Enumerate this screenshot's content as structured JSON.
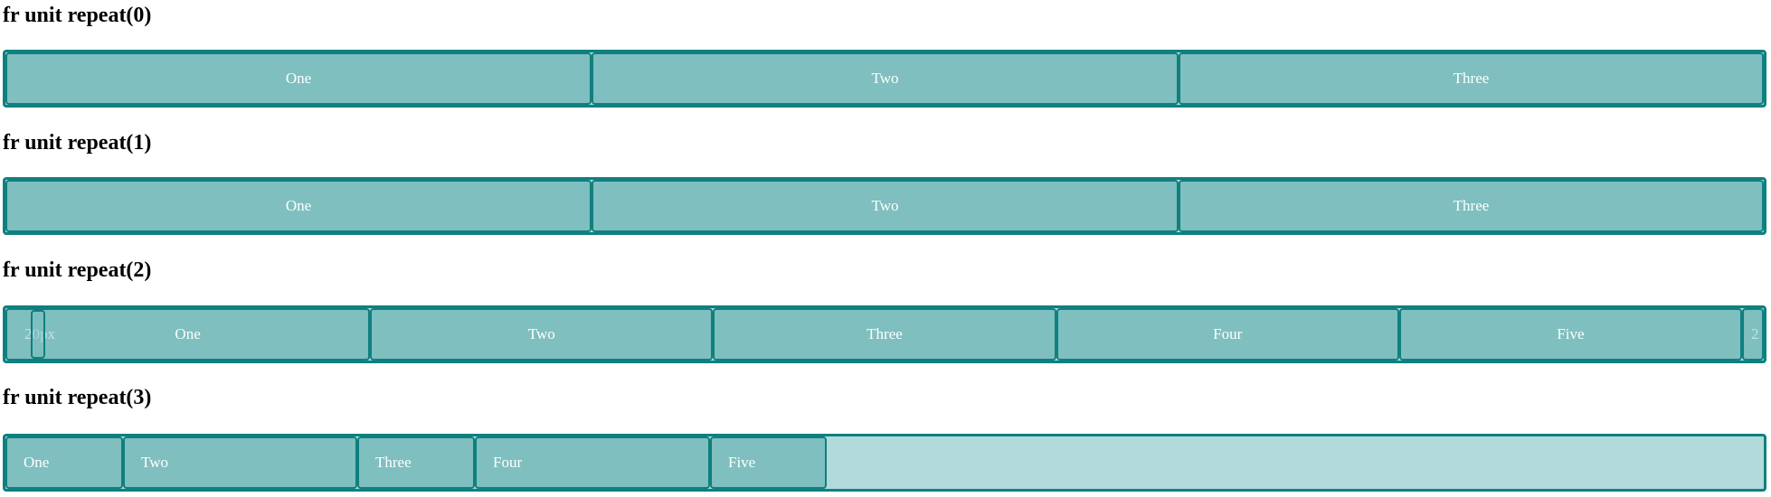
{
  "sections": [
    {
      "title": "fr unit repeat(0)",
      "cells": [
        "One",
        "Two",
        "Three"
      ]
    },
    {
      "title": "fr unit repeat(1)",
      "cells": [
        "One",
        "Two",
        "Three"
      ]
    },
    {
      "title": "fr unit repeat(2)",
      "gap_label": "20px",
      "cells": [
        "One",
        "Two",
        "Three",
        "Four",
        "Five"
      ],
      "overflow_label": "2"
    },
    {
      "title": "fr unit repeat(3)",
      "cells": [
        "One",
        "Two",
        "Three",
        "Four",
        "Five"
      ]
    }
  ]
}
